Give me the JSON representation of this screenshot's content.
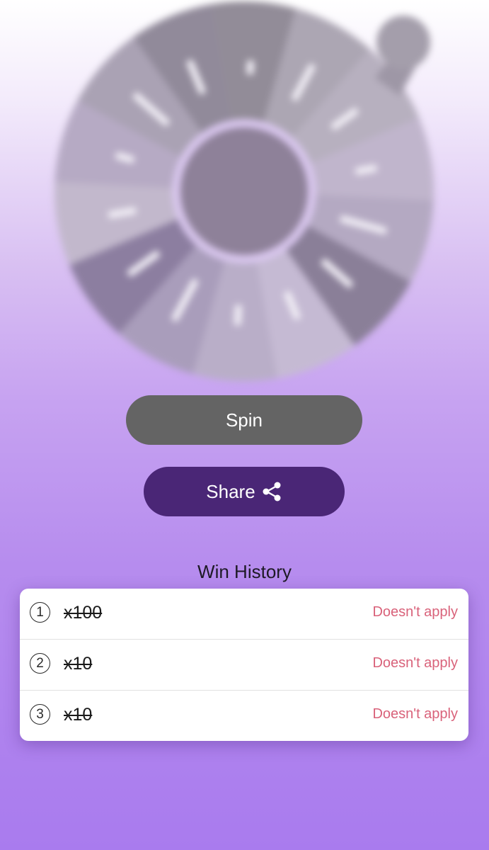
{
  "spin_button": {
    "label": "Spin"
  },
  "share_button": {
    "label": "Share",
    "icon": "share-icon"
  },
  "history": {
    "title": "Win History",
    "rows": [
      {
        "index": "1",
        "value": "x100",
        "status": "Doesn't apply"
      },
      {
        "index": "2",
        "value": "x10",
        "status": "Doesn't apply"
      },
      {
        "index": "3",
        "value": "x10",
        "status": "Doesn't apply"
      }
    ]
  },
  "colors": {
    "spin_button_bg": "#646464",
    "share_button_bg": "#4a2676",
    "status_text": "#d9627a",
    "background_bottom": "#a97bee"
  }
}
